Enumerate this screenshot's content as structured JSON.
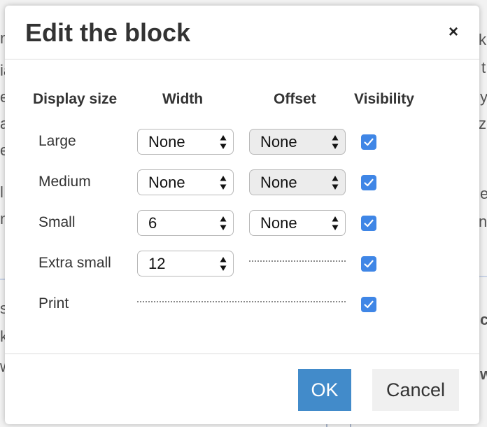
{
  "background": {
    "left_fragments": [
      "n",
      "ia",
      "e",
      "a",
      "e",
      "l",
      "n",
      "s",
      "k",
      "w"
    ],
    "right_fragments": [
      "ke",
      "t",
      "y",
      "ze",
      "e",
      "n'",
      "c",
      "w"
    ]
  },
  "dialog": {
    "title": "Edit the block",
    "close_label": "×"
  },
  "columns": {
    "display_size": "Display size",
    "width": "Width",
    "offset": "Offset",
    "visibility": "Visibility"
  },
  "rows": [
    {
      "label": "Large",
      "width": "None",
      "offset": "None",
      "visible": true
    },
    {
      "label": "Medium",
      "width": "None",
      "offset": "None",
      "visible": true
    },
    {
      "label": "Small",
      "width": "6",
      "offset": "None",
      "visible": true
    },
    {
      "label": "Extra small",
      "width": "12",
      "offset": null,
      "visible": true
    },
    {
      "label": "Print",
      "width": null,
      "offset": null,
      "visible": true
    }
  ],
  "footer": {
    "ok_label": "OK",
    "cancel_label": "Cancel"
  },
  "colors": {
    "accent": "#428bca",
    "checkbox": "#3f86e6"
  }
}
